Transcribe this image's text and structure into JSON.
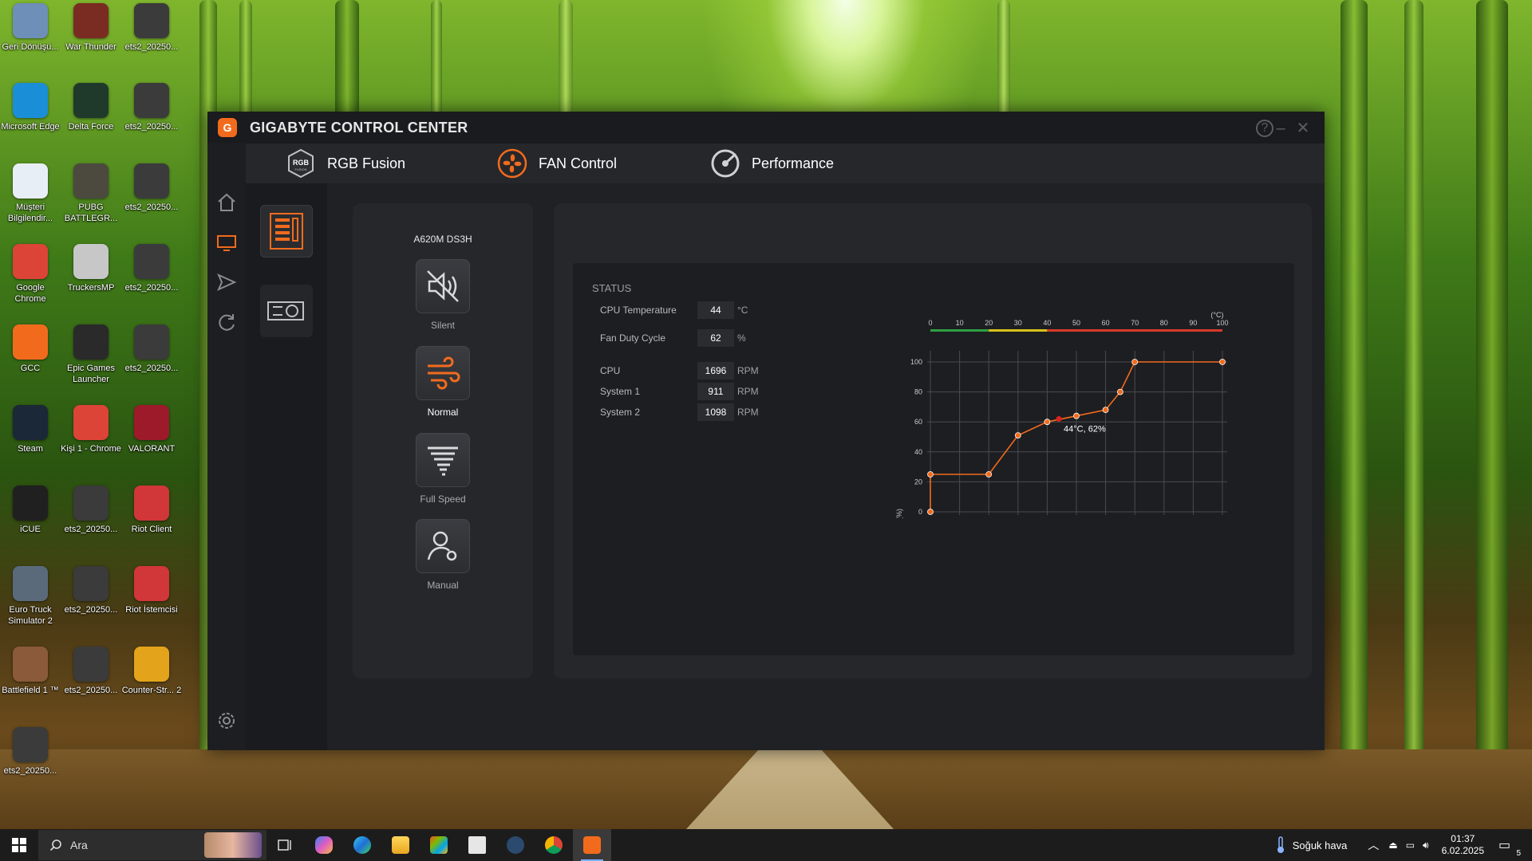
{
  "desktop": {
    "icons": [
      {
        "label": "Geri Dönüşü...",
        "icon": "recycle-bin-icon",
        "color": "#6d8fb8"
      },
      {
        "label": "War Thunder",
        "icon": "war-thunder-icon",
        "color": "#7a2c22"
      },
      {
        "label": "ets2_20250...",
        "icon": "screenshot-icon",
        "color": "#3b3b3b"
      },
      {
        "label": "Microsoft Edge",
        "icon": "edge-icon",
        "color": "#1a8fd8"
      },
      {
        "label": "Delta Force",
        "icon": "delta-force-icon",
        "color": "#1f3a2a"
      },
      {
        "label": "ets2_20250...",
        "icon": "screenshot-icon",
        "color": "#3b3b3b"
      },
      {
        "label": "Müşteri Bilgilendir...",
        "icon": "document-icon",
        "color": "#e8eef6"
      },
      {
        "label": "PUBG BATTLEGR...",
        "icon": "pubg-icon",
        "color": "#4c4a3f"
      },
      {
        "label": "ets2_20250...",
        "icon": "screenshot-icon",
        "color": "#3b3b3b"
      },
      {
        "label": "Google Chrome",
        "icon": "chrome-icon",
        "color": "#db4437"
      },
      {
        "label": "TruckersMP",
        "icon": "truckersmp-icon",
        "color": "#c7c7c7"
      },
      {
        "label": "ets2_20250...",
        "icon": "screenshot-icon",
        "color": "#3b3b3b"
      },
      {
        "label": "GCC",
        "icon": "gcc-icon",
        "color": "#f26b1d"
      },
      {
        "label": "Epic Games Launcher",
        "icon": "epic-games-icon",
        "color": "#2a2a2a"
      },
      {
        "label": "ets2_20250...",
        "icon": "screenshot-icon",
        "color": "#3b3b3b"
      },
      {
        "label": "Steam",
        "icon": "steam-icon",
        "color": "#1b2838"
      },
      {
        "label": "Kişi 1 - Chrome",
        "icon": "chrome-profile-icon",
        "color": "#db4437"
      },
      {
        "label": "VALORANT",
        "icon": "valorant-icon",
        "color": "#9c1a2a"
      },
      {
        "label": "iCUE",
        "icon": "icue-icon",
        "color": "#202020"
      },
      {
        "label": "ets2_20250...",
        "icon": "screenshot-icon",
        "color": "#3b3b3b"
      },
      {
        "label": "Riot Client",
        "icon": "riot-client-icon",
        "color": "#d13639"
      },
      {
        "label": "Euro Truck Simulator 2",
        "icon": "ets2-icon",
        "color": "#5a6a7a"
      },
      {
        "label": "ets2_20250...",
        "icon": "screenshot-icon",
        "color": "#3b3b3b"
      },
      {
        "label": "Riot İstemcisi",
        "icon": "riot-client-icon",
        "color": "#d13639"
      },
      {
        "label": "Battlefield 1 ™",
        "icon": "battlefield-icon",
        "color": "#8a5a3a"
      },
      {
        "label": "ets2_20250...",
        "icon": "screenshot-icon",
        "color": "#3b3b3b"
      },
      {
        "label": "Counter-Str... 2",
        "icon": "cs2-icon",
        "color": "#e3a31b"
      },
      {
        "label": "ets2_20250...",
        "icon": "screenshot-icon",
        "color": "#3b3b3b"
      }
    ]
  },
  "window": {
    "title": "GIGABYTE CONTROL CENTER",
    "accent": "#f26b1d",
    "tabs": [
      {
        "label": "RGB Fusion",
        "icon": "rgb-fusion-icon"
      },
      {
        "label": "FAN Control",
        "icon": "fan-icon",
        "active": true
      },
      {
        "label": "Performance",
        "icon": "performance-gauge-icon"
      }
    ]
  },
  "modes": {
    "board": "A620M DS3H",
    "items": [
      {
        "label": "Silent",
        "icon": "speaker-muted-icon"
      },
      {
        "label": "Normal",
        "icon": "wind-icon",
        "selected": true
      },
      {
        "label": "Full Speed",
        "icon": "tornado-icon"
      },
      {
        "label": "Manual",
        "icon": "user-gear-icon"
      }
    ]
  },
  "status": {
    "title": "STATUS",
    "cpu_temp": {
      "label": "CPU Temperature",
      "value": "44",
      "unit": "°C"
    },
    "fan_duty": {
      "label": "Fan Duty Cycle",
      "value": "62",
      "unit": "%"
    },
    "fans": [
      {
        "label": "CPU",
        "value": "1696",
        "unit": "RPM"
      },
      {
        "label": "System 1",
        "value": "911",
        "unit": "RPM"
      },
      {
        "label": "System 2",
        "value": "1098",
        "unit": "RPM"
      }
    ]
  },
  "chart_data": {
    "type": "line",
    "x_unit_label": "(°C)",
    "y_unit_label": "(%)",
    "xlim": [
      0,
      100
    ],
    "ylim": [
      0,
      100
    ],
    "x_ticks": [
      0,
      10,
      20,
      30,
      40,
      50,
      60,
      70,
      80,
      90,
      100
    ],
    "y_ticks": [
      0,
      20,
      40,
      60,
      80,
      100
    ],
    "grid": true,
    "series": [
      {
        "points": [
          [
            0,
            0
          ],
          [
            0,
            25
          ],
          [
            20,
            25
          ],
          [
            30,
            51
          ],
          [
            40,
            60
          ],
          [
            50,
            64
          ],
          [
            60,
            68
          ],
          [
            65,
            80
          ],
          [
            70,
            100
          ],
          [
            100,
            100
          ]
        ],
        "color": "#f26b1d"
      }
    ],
    "current_point": {
      "x": 44,
      "y": 62,
      "label": "44°C, 62%",
      "color": "#e02020"
    },
    "temp_scale_colors": [
      "#2ea043",
      "#d6c21b",
      "#d73a2a"
    ]
  },
  "taskbar": {
    "search_placeholder": "Ara",
    "weather": "Soğuk hava",
    "time": "01:37",
    "date": "6.02.2025",
    "notification_count": "5"
  }
}
